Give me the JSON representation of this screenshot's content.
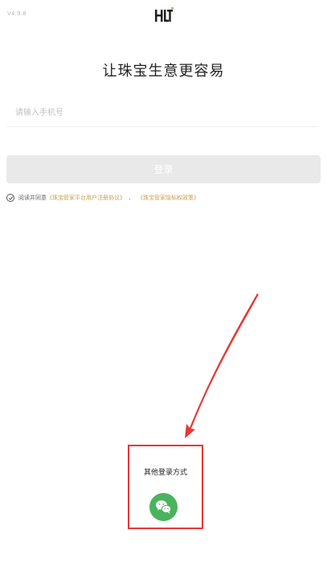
{
  "header": {
    "version": "V4.9.8",
    "logo_icon": "hlt-logo"
  },
  "title": "让珠宝生意更容易",
  "phone": {
    "placeholder": "请输入手机号",
    "value": ""
  },
  "login_button": {
    "label": "登录",
    "state": "disabled"
  },
  "agreement": {
    "checked": true,
    "prefix": "阅读并同意",
    "link1": "《珠宝管家平台用户注册协议》",
    "separator": "、",
    "link2": "《珠宝管家隐私权政策》"
  },
  "other_login": {
    "label": "其他登录方式",
    "wechat_icon": "wechat-icon"
  },
  "colors": {
    "accent_gold": "#c9a055",
    "wechat_green": "#49b35d",
    "annotation_red": "#e53935",
    "disabled_button": "#e9e9e9"
  }
}
